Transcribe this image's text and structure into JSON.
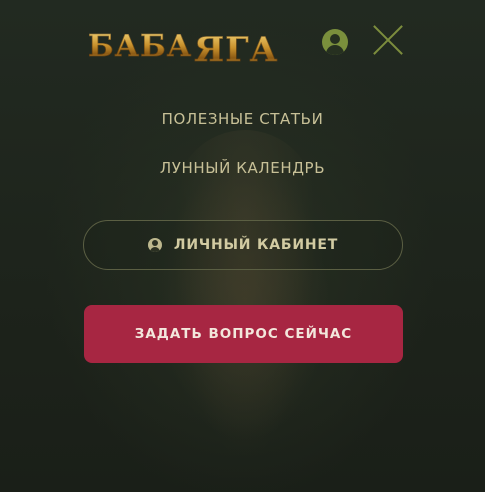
{
  "header": {
    "logo_part1": "БАБА",
    "logo_part2": "ЯГА",
    "profile_icon": "user-icon",
    "close_icon": "close-icon"
  },
  "nav": {
    "items": [
      {
        "label": "ПОЛЕЗНЫЕ СТАТЬИ"
      },
      {
        "label": "ЛУННЫЙ КАЛЕНДРЬ"
      }
    ]
  },
  "cabinet": {
    "label": "ЛИЧНЫЙ КАБИНЕТ",
    "icon": "user-icon"
  },
  "cta": {
    "label": "ЗАДАТЬ ВОПРОС СЕЙЧАС"
  },
  "colors": {
    "background": "#1f241c",
    "accent_green": "#7a8f3c",
    "text": "#c7c097",
    "cta_bg": "#a72642",
    "logo_gold": "#c8912c"
  }
}
